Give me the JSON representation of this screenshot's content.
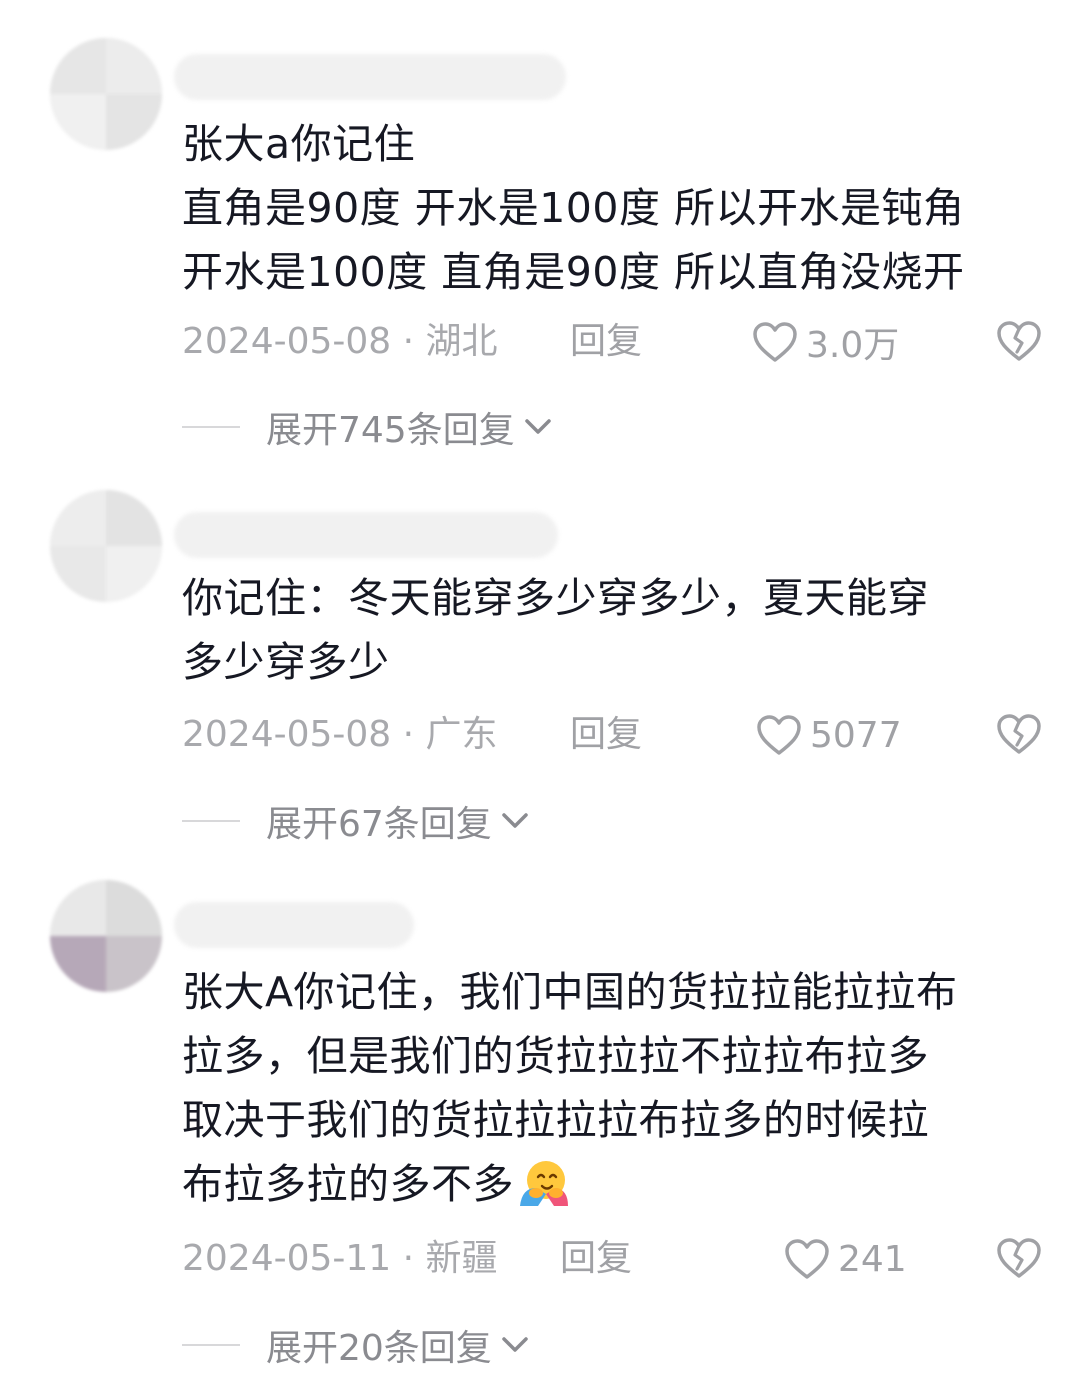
{
  "comments": [
    {
      "lines": [
        "张大a你记住",
        "直角是90度 开水是100度 所以开水是钝角",
        "开水是100度 直角是90度 所以直角没烧开"
      ],
      "date_location": "2024-05-08 · 湖北",
      "reply_label": "回复",
      "likes": "3.0万",
      "expand_label": "展开745条回复"
    },
    {
      "lines": [
        "你记住：冬天能穿多少穿多少，夏天能穿",
        "多少穿多少"
      ],
      "date_location": "2024-05-08 · 广东",
      "reply_label": "回复",
      "likes": "5077",
      "expand_label": "展开67条回复"
    },
    {
      "lines": [
        "张大A你记住，我们中国的货拉拉能拉拉布",
        "拉多，但是我们的货拉拉拉不拉拉布拉多",
        "取决于我们的货拉拉拉拉布拉多的时候拉",
        "布拉多拉的多不多"
      ],
      "emoji": "hugging-face-emoji",
      "date_location": "2024-05-11 · 新疆",
      "reply_label": "回复",
      "likes": "241",
      "expand_label": "展开20条回复"
    }
  ],
  "icons": {
    "like": "heart-outline-icon",
    "dislike": "broken-heart-icon",
    "expand": "chevron-down-icon"
  },
  "colors": {
    "text": "#161823",
    "meta": "#a8a9ad",
    "expand": "#8a8b90"
  }
}
